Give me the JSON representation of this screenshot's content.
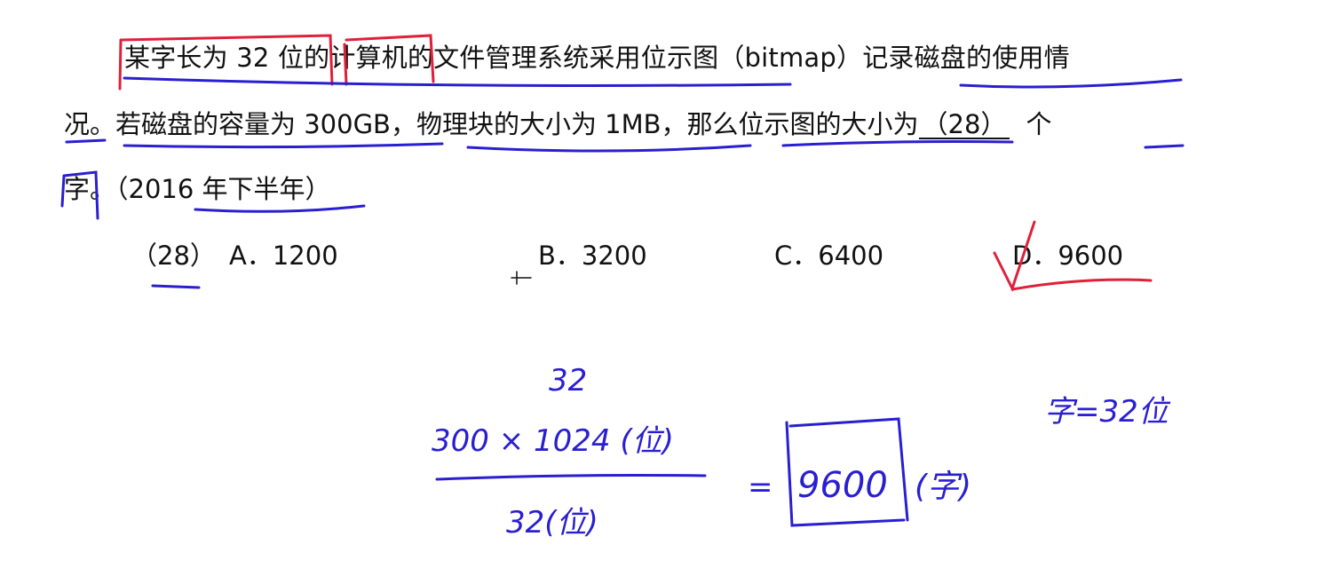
{
  "question": {
    "line1": "某字长为 32 位的计算机的文件管理系统采用位示图（bitmap）记录磁盘的使用情",
    "line2_pre": "况。若磁盘的容量为 300GB，物理块的大小为 1MB，那么位示图的大小为",
    "blank": "（28）",
    "line2_post": "个",
    "line3": "字。（2016 年下半年）"
  },
  "options": {
    "number": "（28）",
    "a": "A．1200",
    "b": "B．3200",
    "c": "C．6400",
    "d": "D．9600"
  },
  "handwriting": {
    "top": "32",
    "numerator": "300 × 1024 (位)",
    "denominator": "32(位)",
    "equals": "=",
    "result": "9600",
    "unit": "(字)",
    "note": "字=32位"
  },
  "colors": {
    "annotation_blue": "#2a1fd0",
    "annotation_red": "#e0203a"
  }
}
